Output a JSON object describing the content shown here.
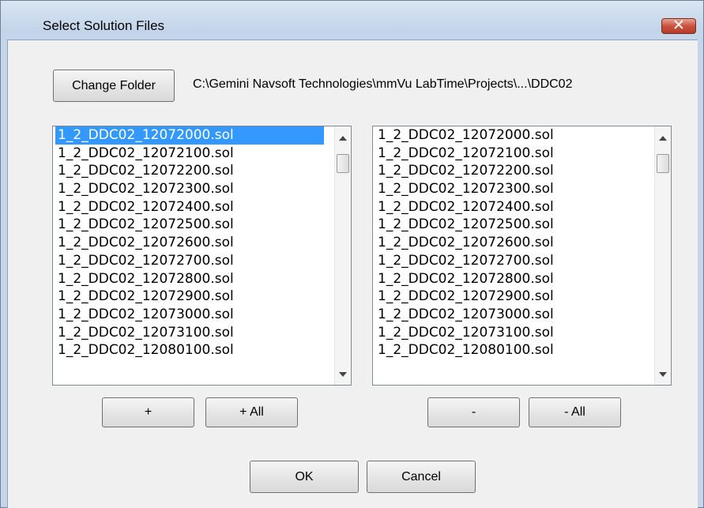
{
  "window": {
    "title": "Select Solution Files"
  },
  "icons": {
    "close": "close-icon"
  },
  "folder": {
    "change_label": "Change Folder",
    "path": "C:\\Gemini Navsoft Technologies\\mmVu LabTime\\Projects\\...\\DDC02"
  },
  "left_list": {
    "selected_index": 0,
    "items": [
      "1_2_DDC02_12072000.sol",
      "1_2_DDC02_12072100.sol",
      "1_2_DDC02_12072200.sol",
      "1_2_DDC02_12072300.sol",
      "1_2_DDC02_12072400.sol",
      "1_2_DDC02_12072500.sol",
      "1_2_DDC02_12072600.sol",
      "1_2_DDC02_12072700.sol",
      "1_2_DDC02_12072800.sol",
      "1_2_DDC02_12072900.sol",
      "1_2_DDC02_12073000.sol",
      "1_2_DDC02_12073100.sol",
      "1_2_DDC02_12080100.sol"
    ]
  },
  "right_list": {
    "items": [
      "1_2_DDC02_12072000.sol",
      "1_2_DDC02_12072100.sol",
      "1_2_DDC02_12072200.sol",
      "1_2_DDC02_12072300.sol",
      "1_2_DDC02_12072400.sol",
      "1_2_DDC02_12072500.sol",
      "1_2_DDC02_12072600.sol",
      "1_2_DDC02_12072700.sol",
      "1_2_DDC02_12072800.sol",
      "1_2_DDC02_12072900.sol",
      "1_2_DDC02_12073000.sol",
      "1_2_DDC02_12073100.sol",
      "1_2_DDC02_12080100.sol"
    ]
  },
  "buttons": {
    "add": "+",
    "add_all": "+ All",
    "remove": "-",
    "remove_all": "- All",
    "ok": "OK",
    "cancel": "Cancel"
  }
}
